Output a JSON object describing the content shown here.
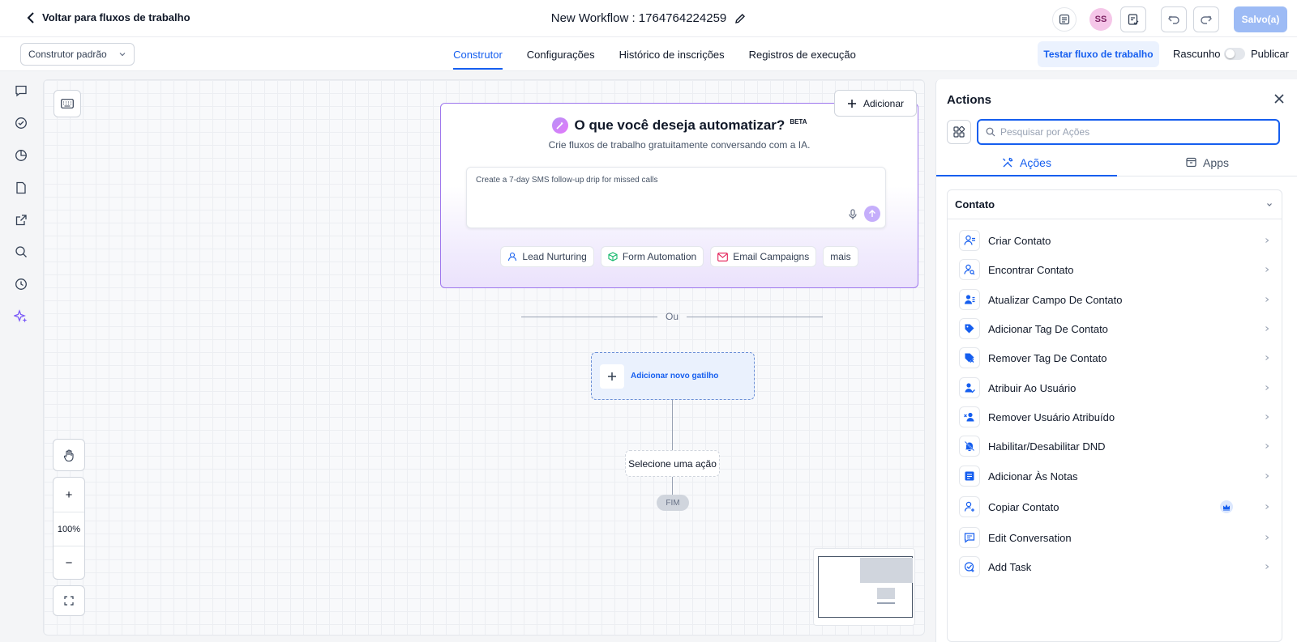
{
  "header": {
    "back_label": "Voltar para fluxos de trabalho",
    "workflow_title": "New Workflow : 1764764224259",
    "avatar_initials": "SS",
    "saved_label": "Salvo(a)"
  },
  "subbar": {
    "builder_select": "Construtor padrão",
    "tabs": [
      {
        "label": "Construtor",
        "active": true
      },
      {
        "label": "Configurações"
      },
      {
        "label": "Histórico de inscrições"
      },
      {
        "label": "Registros de execução"
      }
    ],
    "test_button": "Testar fluxo de trabalho",
    "draft_label": "Rascunho",
    "publish_label": "Publicar"
  },
  "canvas": {
    "add_button": "Adicionar",
    "ai": {
      "title": "O que você deseja automatizar?",
      "beta": "BETA",
      "subtitle": "Crie fluxos de trabalho gratuitamente conversando com a IA.",
      "prompt": "Create a 7-day SMS follow-up drip for missed calls",
      "chips": [
        "Lead Nurturing",
        "Form Automation",
        "Email Campaigns",
        "mais"
      ]
    },
    "or_label": "Ou",
    "trigger_label": "Adicionar novo gatilho",
    "action_node": "Selecione uma ação",
    "end_label": "FIM",
    "zoom_level": "100%",
    "zoom_in": "+",
    "zoom_out": "−"
  },
  "panel": {
    "title": "Actions",
    "search_placeholder": "Pesquisar por Ações",
    "tabs": [
      {
        "label": "Ações",
        "active": true
      },
      {
        "label": "Apps"
      }
    ],
    "group_title": "Contato",
    "actions": [
      {
        "label": "Criar Contato",
        "icon": "user-plus-icon"
      },
      {
        "label": "Encontrar Contato",
        "icon": "user-search-icon"
      },
      {
        "label": "Atualizar Campo De Contato",
        "icon": "user-edit-icon"
      },
      {
        "label": "Adicionar Tag De Contato",
        "icon": "tag-icon"
      },
      {
        "label": "Remover Tag De Contato",
        "icon": "tag-remove-icon"
      },
      {
        "label": "Atribuir Ao Usuário",
        "icon": "user-assign-icon"
      },
      {
        "label": "Remover Usuário Atribuído",
        "icon": "user-remove-icon"
      },
      {
        "label": "Habilitar/Desabilitar DND",
        "icon": "bell-off-icon"
      },
      {
        "label": "Adicionar Às Notas",
        "icon": "note-icon"
      },
      {
        "label": "Copiar Contato",
        "icon": "user-copy-icon",
        "premium": true
      },
      {
        "label": "Edit Conversation",
        "icon": "chat-icon"
      },
      {
        "label": "Add Task",
        "icon": "task-icon"
      }
    ]
  },
  "colors": {
    "accent": "#155eef",
    "ai_border": "#9e77ed",
    "saved_button": "#9dbbf5"
  }
}
